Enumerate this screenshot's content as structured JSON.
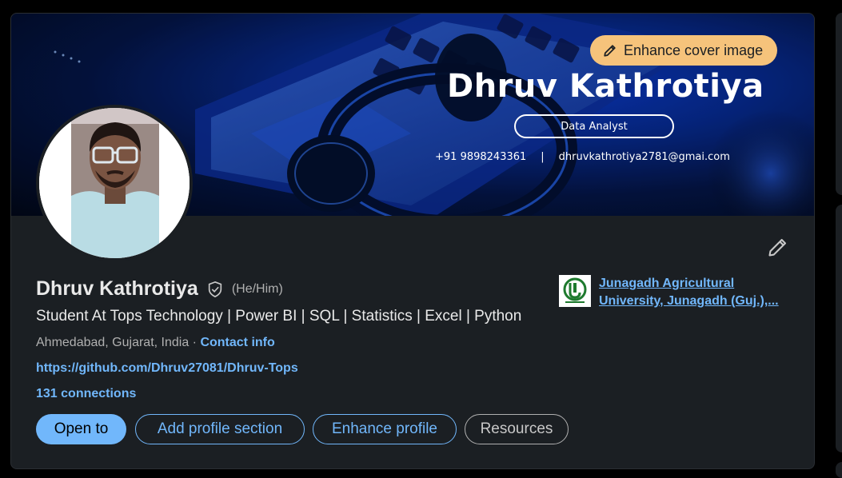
{
  "cover": {
    "name": "Dhruv Kathrotiya",
    "role": "Data Analyst",
    "phone": "+91 9898243361",
    "separator": "|",
    "email": "dhruvkathrotiya2781@gmai.com",
    "enhance_label": "Enhance cover image"
  },
  "profile": {
    "name": "Dhruv Kathrotiya",
    "pronouns": "(He/Him)",
    "headline": "Student At Tops Technology | Power BI | SQL | Statistics | Excel | Python",
    "location": "Ahmedabad, Gujarat, India",
    "location_sep": " · ",
    "contact_info": "Contact info",
    "website": "https://github.com/Dhruv27081/Dhruv-Tops",
    "connections": "131 connections"
  },
  "education": {
    "line1": "Junagadh Agricultural",
    "line2": "University, Junagadh (Guj.),..."
  },
  "buttons": {
    "open_to": "Open to",
    "add_section": "Add profile section",
    "enhance": "Enhance profile",
    "resources": "Resources"
  },
  "colors": {
    "link": "#71b7fb",
    "card_bg": "#1b1f23",
    "enhance_bg": "#f6c37b"
  }
}
